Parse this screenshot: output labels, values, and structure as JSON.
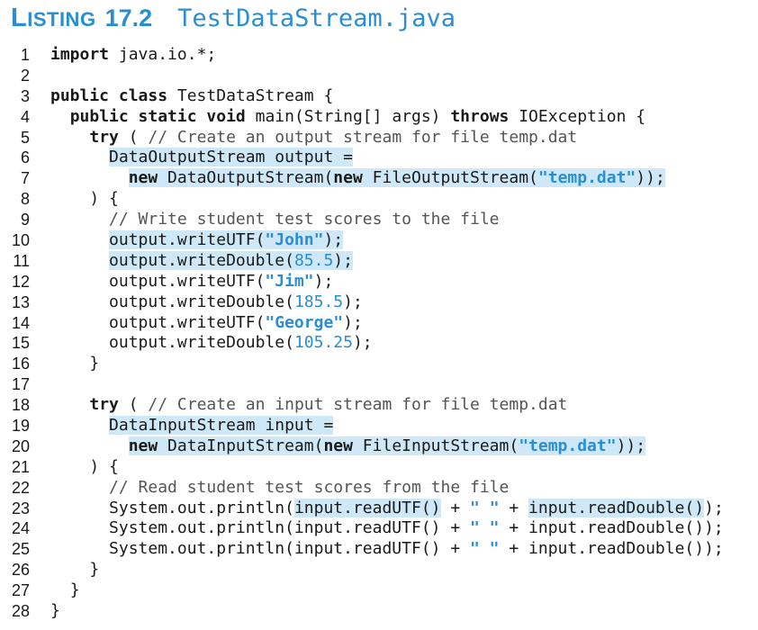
{
  "listing": {
    "label_first": "L",
    "label_rest": "ISTING",
    "number": "17.2",
    "filename": "TestDataStream.java"
  },
  "lines": [
    {
      "n": "1",
      "indent": "",
      "segs": [
        {
          "t": "import",
          "c": "kw"
        },
        {
          "t": " java.io.*;",
          "c": ""
        }
      ]
    },
    {
      "n": "2",
      "indent": "",
      "segs": []
    },
    {
      "n": "3",
      "indent": "",
      "segs": [
        {
          "t": "public class",
          "c": "kw"
        },
        {
          "t": " TestDataStream {",
          "c": ""
        }
      ]
    },
    {
      "n": "4",
      "indent": "  ",
      "segs": [
        {
          "t": "public static void",
          "c": "kw"
        },
        {
          "t": " main(String[] args) ",
          "c": ""
        },
        {
          "t": "throws",
          "c": "kw"
        },
        {
          "t": " IOException {",
          "c": ""
        }
      ]
    },
    {
      "n": "5",
      "indent": "    ",
      "segs": [
        {
          "t": "try",
          "c": "kw"
        },
        {
          "t": " ( ",
          "c": ""
        },
        {
          "t": "// Create an output stream for file temp.dat",
          "c": "cm"
        }
      ]
    },
    {
      "n": "6",
      "indent": "      ",
      "segs": [
        {
          "t": "DataOutputStream output =",
          "c": "hl"
        }
      ]
    },
    {
      "n": "7",
      "indent": "        ",
      "segs": [
        {
          "t": "new",
          "c": "hl kw"
        },
        {
          "t": " DataOutputStream(",
          "c": "hl"
        },
        {
          "t": "new",
          "c": "hl kw"
        },
        {
          "t": " FileOutputStream(",
          "c": "hl"
        },
        {
          "t": "\"temp.dat\"",
          "c": "hl str"
        },
        {
          "t": "));",
          "c": "hl"
        }
      ]
    },
    {
      "n": "8",
      "indent": "    ",
      "segs": [
        {
          "t": ") {",
          "c": ""
        }
      ]
    },
    {
      "n": "9",
      "indent": "      ",
      "segs": [
        {
          "t": "// Write student test scores to the file",
          "c": "cm"
        }
      ]
    },
    {
      "n": "10",
      "indent": "      ",
      "segs": [
        {
          "t": "output.writeUTF(",
          "c": "hl"
        },
        {
          "t": "\"John\"",
          "c": "hl str"
        },
        {
          "t": ");",
          "c": "hl"
        }
      ]
    },
    {
      "n": "11",
      "indent": "      ",
      "segs": [
        {
          "t": "output.writeDouble(",
          "c": "hl"
        },
        {
          "t": "85.5",
          "c": "hl num"
        },
        {
          "t": ");",
          "c": "hl"
        }
      ]
    },
    {
      "n": "12",
      "indent": "      ",
      "segs": [
        {
          "t": "output.writeUTF(",
          "c": ""
        },
        {
          "t": "\"Jim\"",
          "c": "str"
        },
        {
          "t": ");",
          "c": ""
        }
      ]
    },
    {
      "n": "13",
      "indent": "      ",
      "segs": [
        {
          "t": "output.writeDouble(",
          "c": ""
        },
        {
          "t": "185.5",
          "c": "num"
        },
        {
          "t": ");",
          "c": ""
        }
      ]
    },
    {
      "n": "14",
      "indent": "      ",
      "segs": [
        {
          "t": "output.writeUTF(",
          "c": ""
        },
        {
          "t": "\"George\"",
          "c": "str"
        },
        {
          "t": ");",
          "c": ""
        }
      ]
    },
    {
      "n": "15",
      "indent": "      ",
      "segs": [
        {
          "t": "output.writeDouble(",
          "c": ""
        },
        {
          "t": "105.25",
          "c": "num"
        },
        {
          "t": ");",
          "c": ""
        }
      ]
    },
    {
      "n": "16",
      "indent": "    ",
      "segs": [
        {
          "t": "}",
          "c": ""
        }
      ]
    },
    {
      "n": "17",
      "indent": "",
      "segs": []
    },
    {
      "n": "18",
      "indent": "    ",
      "segs": [
        {
          "t": "try",
          "c": "kw"
        },
        {
          "t": " ( ",
          "c": ""
        },
        {
          "t": "// Create an input stream for file temp.dat",
          "c": "cm"
        }
      ]
    },
    {
      "n": "19",
      "indent": "      ",
      "segs": [
        {
          "t": "DataInputStream input =",
          "c": "hl"
        }
      ]
    },
    {
      "n": "20",
      "indent": "        ",
      "segs": [
        {
          "t": "new",
          "c": "hl kw"
        },
        {
          "t": " DataInputStream(",
          "c": "hl"
        },
        {
          "t": "new",
          "c": "hl kw"
        },
        {
          "t": " FileInputStream(",
          "c": "hl"
        },
        {
          "t": "\"temp.dat\"",
          "c": "hl str"
        },
        {
          "t": "));",
          "c": "hl"
        }
      ]
    },
    {
      "n": "21",
      "indent": "    ",
      "segs": [
        {
          "t": ") {",
          "c": ""
        }
      ]
    },
    {
      "n": "22",
      "indent": "      ",
      "segs": [
        {
          "t": "// Read student test scores from the file",
          "c": "cm"
        }
      ]
    },
    {
      "n": "23",
      "indent": "      ",
      "segs": [
        {
          "t": "System.out.println(",
          "c": ""
        },
        {
          "t": "input.readUTF()",
          "c": "hl"
        },
        {
          "t": " + ",
          "c": ""
        },
        {
          "t": "\" \"",
          "c": "str"
        },
        {
          "t": " + ",
          "c": ""
        },
        {
          "t": "input.readDouble()",
          "c": "hl"
        },
        {
          "t": ");",
          "c": ""
        }
      ]
    },
    {
      "n": "24",
      "indent": "      ",
      "segs": [
        {
          "t": "System.out.println(input.readUTF() + ",
          "c": ""
        },
        {
          "t": "\" \"",
          "c": "str"
        },
        {
          "t": " + input.readDouble());",
          "c": ""
        }
      ]
    },
    {
      "n": "25",
      "indent": "      ",
      "segs": [
        {
          "t": "System.out.println(input.readUTF() + ",
          "c": ""
        },
        {
          "t": "\" \"",
          "c": "str"
        },
        {
          "t": " + input.readDouble());",
          "c": ""
        }
      ]
    },
    {
      "n": "26",
      "indent": "    ",
      "segs": [
        {
          "t": "}",
          "c": ""
        }
      ]
    },
    {
      "n": "27",
      "indent": "  ",
      "segs": [
        {
          "t": "}",
          "c": ""
        }
      ]
    },
    {
      "n": "28",
      "indent": "",
      "segs": [
        {
          "t": "}",
          "c": ""
        }
      ]
    }
  ]
}
